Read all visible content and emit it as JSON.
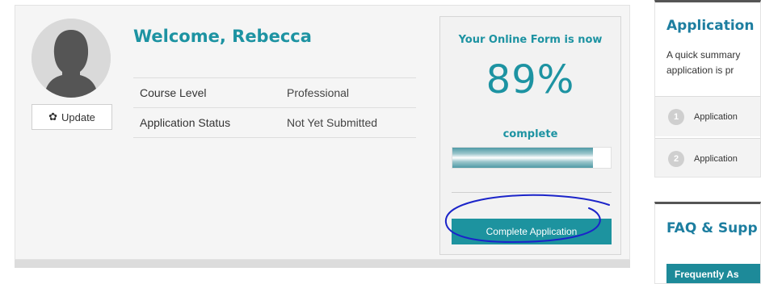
{
  "profile": {
    "update_label": "Update",
    "update_icon": "gear-icon",
    "welcome": "Welcome, Rebecca",
    "rows": [
      {
        "key": "Course Level",
        "value": "Professional"
      },
      {
        "key": "Application Status",
        "value": "Not Yet Submitted"
      }
    ]
  },
  "progress": {
    "title": "Your Online Form is now",
    "percent_text": "89%",
    "percent_value": 89,
    "complete_label": "complete",
    "button_label": "Complete Application"
  },
  "sidebar": {
    "summary_title": "Application",
    "summary_desc_line1": "A quick summary",
    "summary_desc_line2": "application is pr",
    "steps": [
      {
        "num": "1",
        "label": "Application"
      },
      {
        "num": "2",
        "label": "Application"
      }
    ],
    "faq_title": "FAQ & Supp",
    "faq_button": "Frequently As"
  },
  "colors": {
    "accent": "#1d93a2",
    "button": "#1d939f",
    "annotation": "#1b24c9"
  }
}
